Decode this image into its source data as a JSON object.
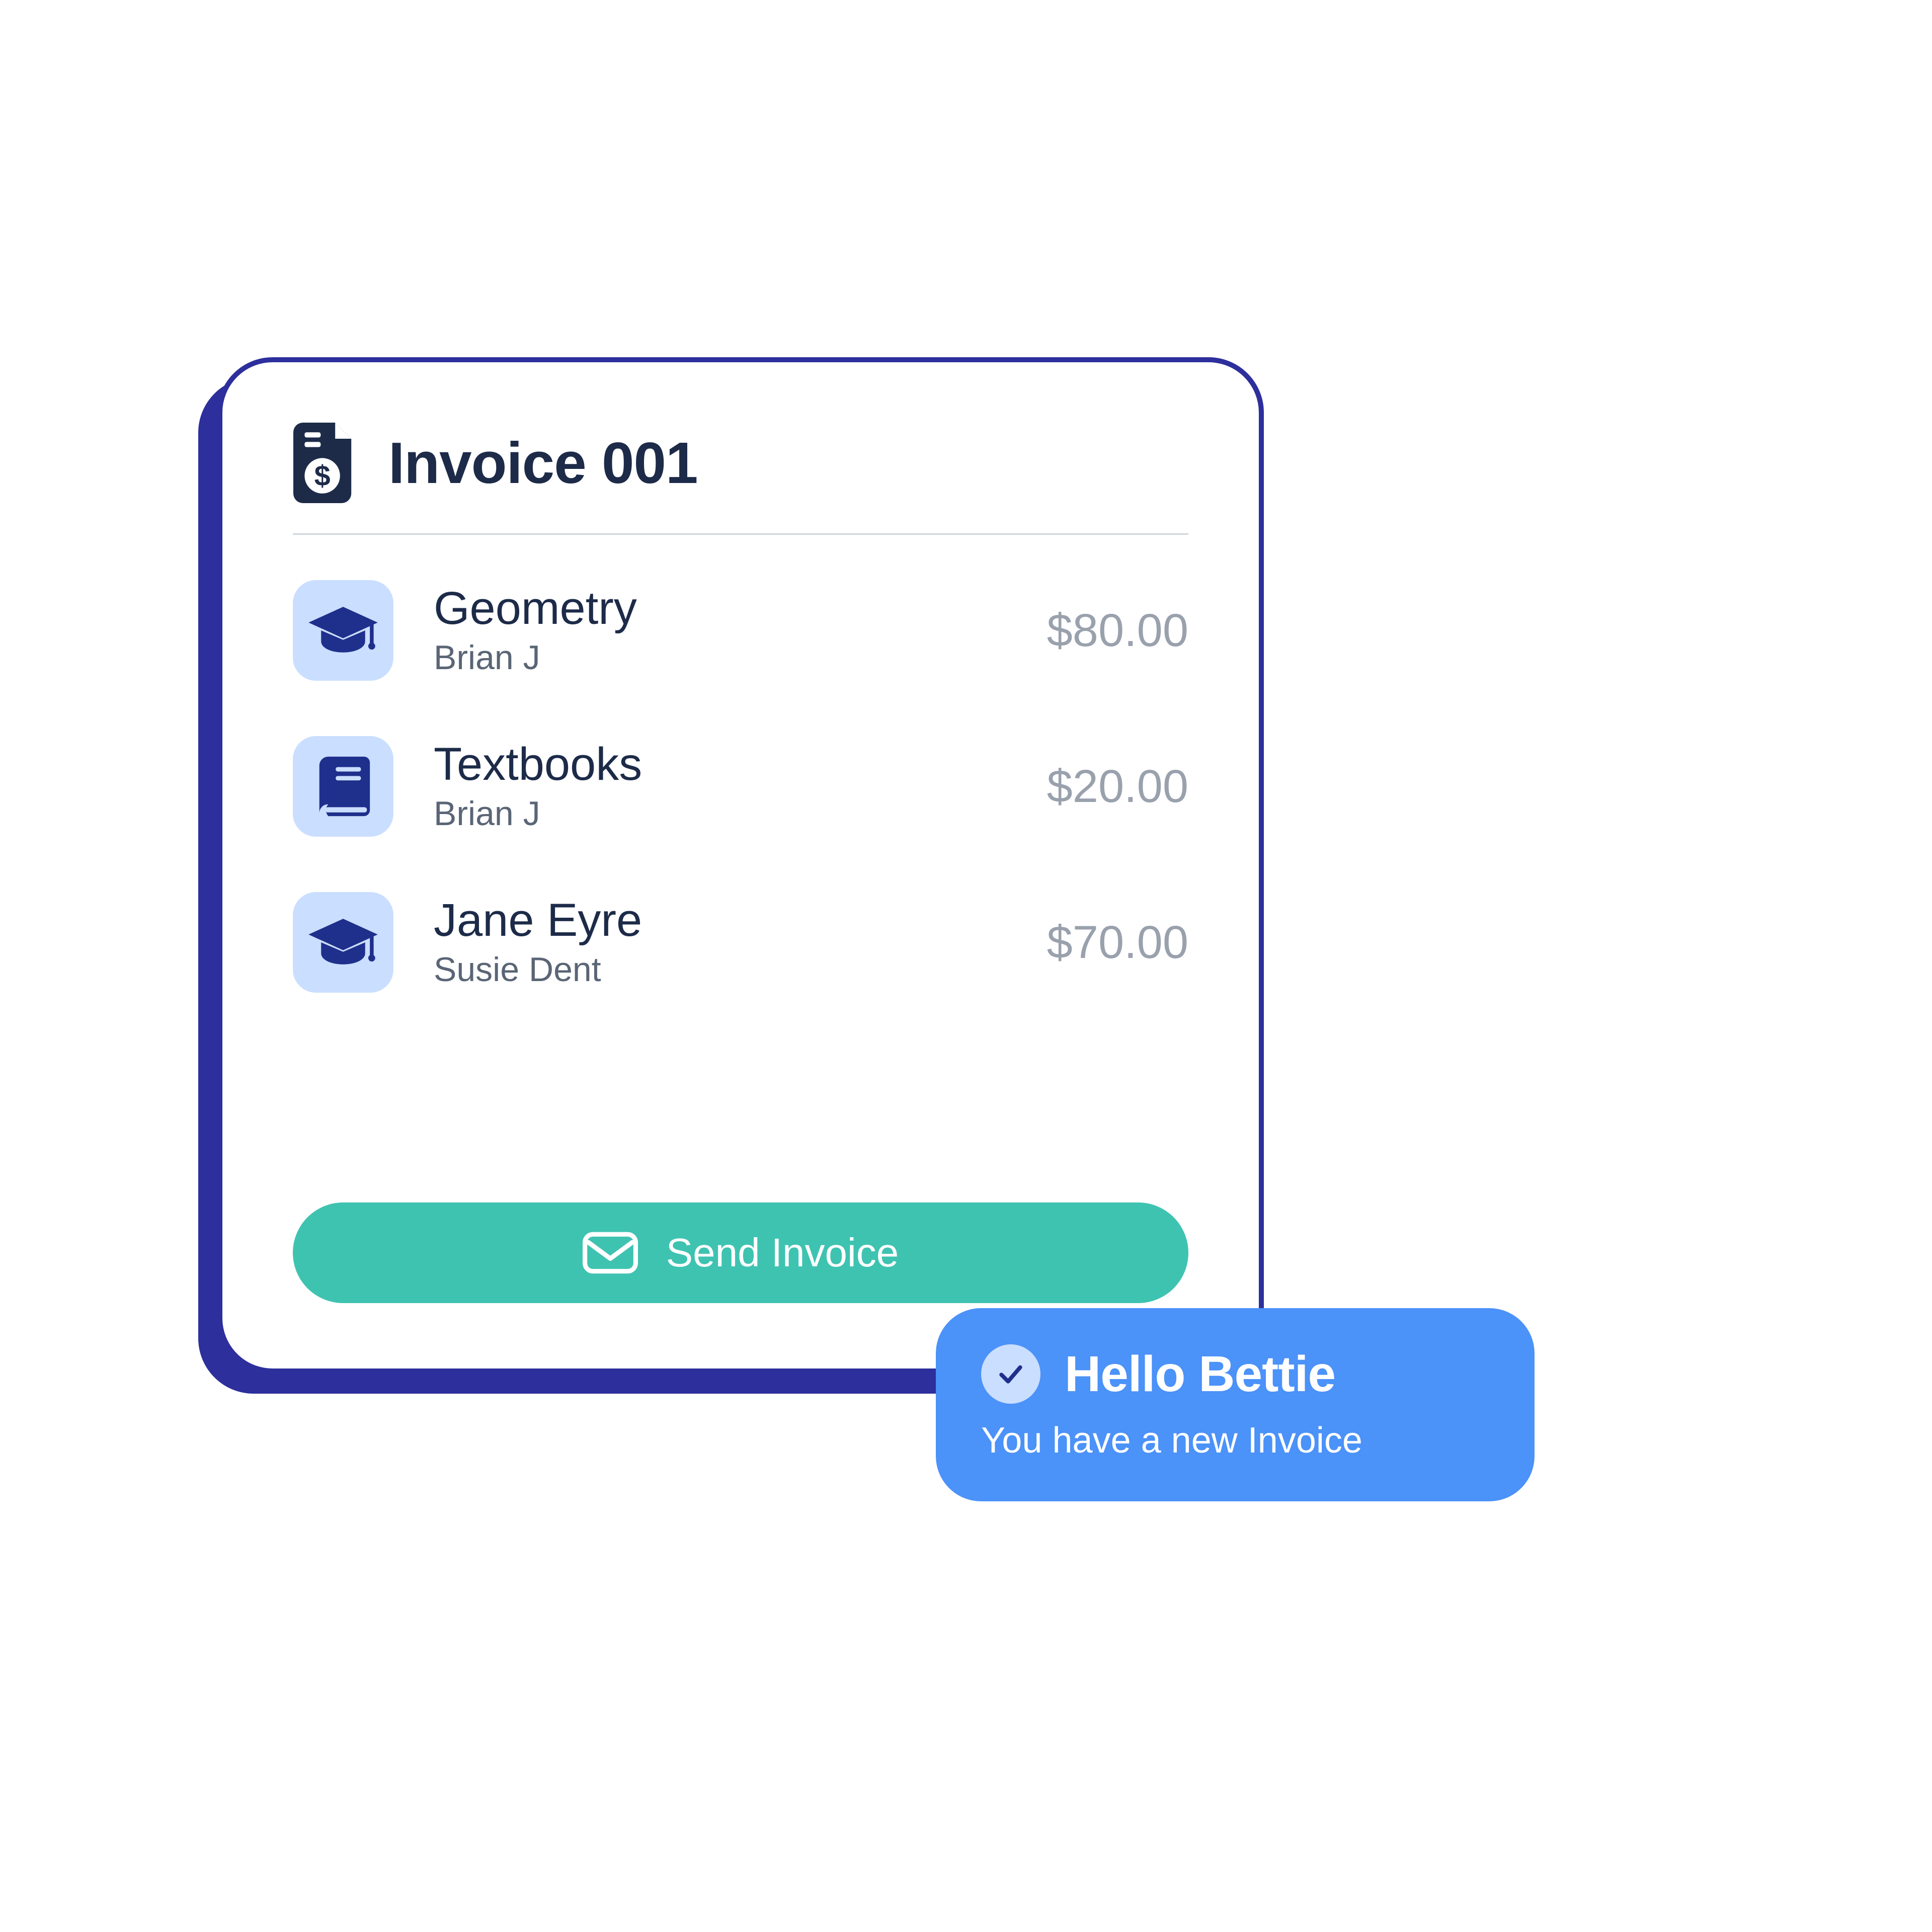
{
  "invoice": {
    "title": "Invoice 001",
    "items": [
      {
        "icon": "cap",
        "title": "Geometry",
        "subtitle": "Brian J",
        "amount": "$80.00"
      },
      {
        "icon": "book",
        "title": "Textbooks",
        "subtitle": "Brian J",
        "amount": "$20.00"
      },
      {
        "icon": "cap",
        "title": "Jane Eyre",
        "subtitle": "Susie Dent",
        "amount": "$70.00"
      }
    ],
    "send_label": "Send Invoice"
  },
  "toast": {
    "title": "Hello Bettie",
    "body": "You have a new Invoice"
  }
}
